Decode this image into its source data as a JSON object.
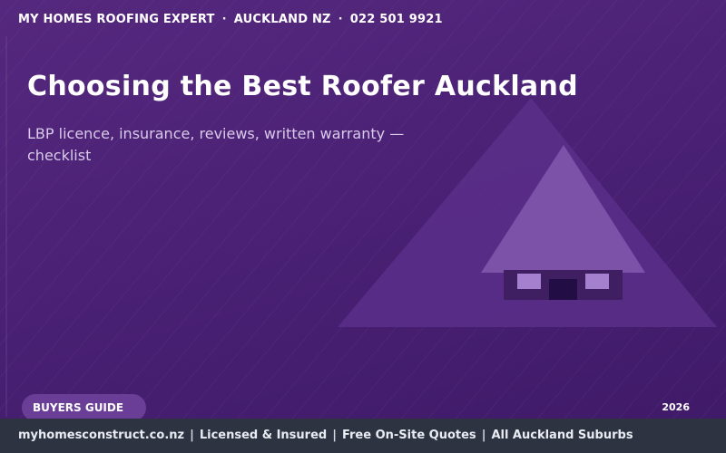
{
  "topbar": {
    "brand": "MY HOMES ROOFING EXPERT",
    "location": "AUCKLAND NZ",
    "phone": "022 501 9921",
    "separator": "·"
  },
  "hero": {
    "headline": "Choosing the Best Roofer Auckland",
    "subtitle": "LBP licence, insurance, reviews, written warranty — checklist"
  },
  "badge": {
    "label": "BUYERS GUIDE"
  },
  "year": "2026",
  "footer": {
    "separator": "|",
    "items": [
      "myhomesconstruct.co.nz",
      "Licensed & Insured",
      "Free On-Site Quotes",
      "All Auckland Suburbs"
    ]
  },
  "illustration": {
    "icon": "house-icon",
    "colors": {
      "big_triangle": "#5a2f8a",
      "roof": "#7b52a8",
      "house_body": "#3f1f62",
      "window": "#a480cf",
      "door": "#220d44"
    }
  },
  "colors": {
    "background": "#4a2175",
    "badge": "#6a3e97",
    "footer": "#2d3340",
    "subtitle": "#d9cbe9"
  }
}
